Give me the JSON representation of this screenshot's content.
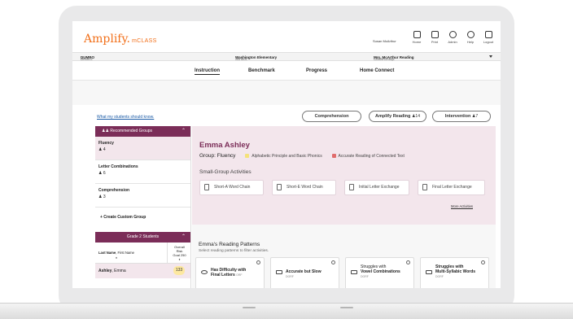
{
  "header": {
    "logo": "Amplify.",
    "logo_sub": "mCLASS",
    "user": "Susan McArthur",
    "icons": [
      {
        "icon": "home-icon",
        "label": "Home"
      },
      {
        "icon": "print-icon",
        "label": "Print"
      },
      {
        "icon": "admin-icon",
        "label": "Admin"
      },
      {
        "icon": "help-icon",
        "label": "Help"
      },
      {
        "icon": "logout-icon",
        "label": "Logout"
      }
    ]
  },
  "filters": {
    "district_label": "District:",
    "district_value": "DUMBO",
    "school_label": "School:",
    "school_value": "Washington Elementary",
    "class_label": "Class/Group:",
    "class_value": "Mrs. McArthur Reading"
  },
  "nav": {
    "tabs": [
      "Instruction",
      "Benchmark",
      "Progress",
      "Home Connect"
    ],
    "active": "Instruction"
  },
  "top": {
    "link": "What my students should know.",
    "pills": [
      {
        "label": "Comprehension",
        "count": ""
      },
      {
        "label": "Amplify Reading",
        "count": "14"
      },
      {
        "label": "Intervention",
        "count": "7"
      }
    ]
  },
  "sidebar": {
    "header": "Recommended Groups",
    "groups": [
      {
        "name": "Fluency",
        "count": "4"
      },
      {
        "name": "Letter Combinations",
        "count": "6"
      },
      {
        "name": "Comprehension",
        "count": "3"
      }
    ],
    "create": "+ Create Custom Group",
    "grade_header": "Grade 2 Students",
    "col_name_bold": "Last Name",
    "col_name_rest": ", First Name",
    "col_risk_1": "Overall",
    "col_risk_2": "Risk",
    "col_risk_3": "Goal 250",
    "row_last": "Ashley",
    "row_first": ", Emma",
    "row_score": "133"
  },
  "student": {
    "name": "Emma Ashley",
    "group": "Group: Fluency",
    "legend": [
      {
        "label": "Alphabetic Principle and Basic Phonics",
        "color": "#f5e27a"
      },
      {
        "label": "Accurate Reading of Connected Text",
        "color": "#e06c6c"
      }
    ],
    "activities_title": "Small-Group Activities",
    "activities": [
      "Short-A Word Chain",
      "Short-E Word Chain",
      "Initial Letter Exchange",
      "Final Letter Exchange"
    ],
    "more": "More Activities"
  },
  "patterns": {
    "title": "Emma's Reading Patterns",
    "subtitle": "Select reading patterns to filter activities.",
    "cards": [
      {
        "line1": "Has Difficulty with",
        "line2": "Final Letters",
        "tag": "ORF"
      },
      {
        "line1": "Accurate but Slow",
        "line2": "",
        "tag": "DORF"
      },
      {
        "line1": "Struggles with",
        "line2": "Vowel Combinations",
        "tag": "DORF"
      },
      {
        "line1": "Struggles with",
        "line2": "Multi-Syllabic Words",
        "tag": "DORF"
      }
    ]
  },
  "colors": {
    "brand": "#f2711c",
    "accent": "#7b2d58",
    "panel": "#f3e6ec"
  }
}
